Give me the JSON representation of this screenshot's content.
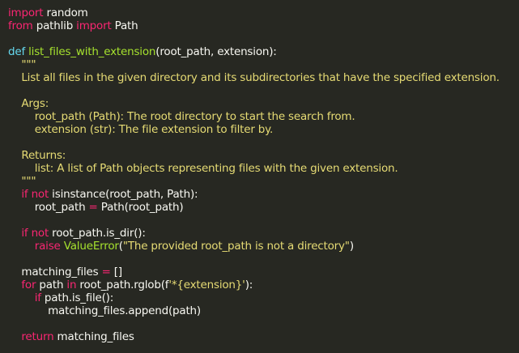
{
  "editor": {
    "lines": [
      [
        {
          "t": "import",
          "c": "kw"
        },
        {
          "t": " random",
          "c": ""
        }
      ],
      [
        {
          "t": "from",
          "c": "kw"
        },
        {
          "t": " pathlib ",
          "c": ""
        },
        {
          "t": "import",
          "c": "kw"
        },
        {
          "t": " Path",
          "c": ""
        }
      ],
      [],
      [
        {
          "t": "def",
          "c": "cls"
        },
        {
          "t": " ",
          "c": ""
        },
        {
          "t": "list_files_with_extension",
          "c": "fn"
        },
        {
          "t": "(root_path, extension):",
          "c": ""
        }
      ],
      [
        {
          "t": "    \"\"\"",
          "c": "doc"
        }
      ],
      [
        {
          "t": "    List all files in the given directory and its subdirectories that have the specified extension.",
          "c": "doc"
        }
      ],
      [],
      [
        {
          "t": "    Args:",
          "c": "doc"
        }
      ],
      [
        {
          "t": "        root_path (Path): The root directory to start the search from.",
          "c": "doc"
        }
      ],
      [
        {
          "t": "        extension (str): The file extension to filter by.",
          "c": "doc"
        }
      ],
      [],
      [
        {
          "t": "    Returns:",
          "c": "doc"
        }
      ],
      [
        {
          "t": "        list: A list of Path objects representing files with the given extension.",
          "c": "doc"
        }
      ],
      [
        {
          "t": "    \"\"\"",
          "c": "doc"
        }
      ],
      [
        {
          "t": "    ",
          "c": ""
        },
        {
          "t": "if",
          "c": "kw"
        },
        {
          "t": " ",
          "c": ""
        },
        {
          "t": "not",
          "c": "kw"
        },
        {
          "t": " isinstance(root_path, Path):",
          "c": ""
        }
      ],
      [
        {
          "t": "        root_path ",
          "c": ""
        },
        {
          "t": "=",
          "c": "op"
        },
        {
          "t": " Path(root_path)",
          "c": ""
        }
      ],
      [],
      [
        {
          "t": "    ",
          "c": ""
        },
        {
          "t": "if",
          "c": "kw"
        },
        {
          "t": " ",
          "c": ""
        },
        {
          "t": "not",
          "c": "kw"
        },
        {
          "t": " root_path.is_dir():",
          "c": ""
        }
      ],
      [
        {
          "t": "        ",
          "c": ""
        },
        {
          "t": "raise",
          "c": "kw"
        },
        {
          "t": " ",
          "c": ""
        },
        {
          "t": "ValueError",
          "c": "fn"
        },
        {
          "t": "(",
          "c": ""
        },
        {
          "t": "\"The provided root_path is not a directory\"",
          "c": "str"
        },
        {
          "t": ")",
          "c": ""
        }
      ],
      [],
      [
        {
          "t": "    matching_files ",
          "c": ""
        },
        {
          "t": "=",
          "c": "op"
        },
        {
          "t": " []",
          "c": ""
        }
      ],
      [
        {
          "t": "    ",
          "c": ""
        },
        {
          "t": "for",
          "c": "kw"
        },
        {
          "t": " path ",
          "c": ""
        },
        {
          "t": "in",
          "c": "kw"
        },
        {
          "t": " root_path.rglob(f",
          "c": ""
        },
        {
          "t": "'*{extension}'",
          "c": "str"
        },
        {
          "t": "):",
          "c": ""
        }
      ],
      [
        {
          "t": "        ",
          "c": ""
        },
        {
          "t": "if",
          "c": "kw"
        },
        {
          "t": " path.is_file():",
          "c": ""
        }
      ],
      [
        {
          "t": "            matching_files.append(path)",
          "c": ""
        }
      ],
      [],
      [
        {
          "t": "    ",
          "c": ""
        },
        {
          "t": "return",
          "c": "kw"
        },
        {
          "t": " matching_files",
          "c": ""
        }
      ]
    ]
  }
}
